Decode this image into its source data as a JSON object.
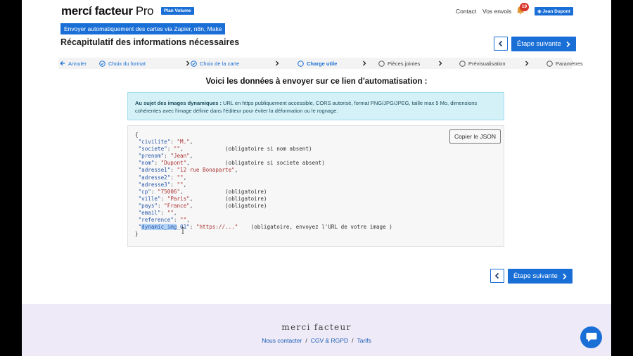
{
  "header": {
    "logo": "mercí facteur",
    "logo_suffix": "Pro",
    "plan_badge": "Plan Volume",
    "contact": "Contact",
    "my_sends": "Vos envois",
    "notif_count": "19",
    "user": "Jean Dupont"
  },
  "banner": "Envoyer automatiquement des cartes via Zapier, n8n, Make",
  "page_title": "Récapitulatif des informations nécessaires",
  "next_step": "Étape suivante",
  "stepper": {
    "cancel": "Annuler",
    "steps": [
      {
        "label": "Choix du format",
        "state": "done"
      },
      {
        "label": "Choix de la carte",
        "state": "done"
      },
      {
        "label": "Charge utile",
        "state": "current"
      },
      {
        "label": "Pièces jointes",
        "state": "todo"
      },
      {
        "label": "Prévisualisation",
        "state": "todo"
      },
      {
        "label": "Paramètres",
        "state": "todo"
      }
    ]
  },
  "lead": "Voici les données à envoyer sur ce lien d'automatisation :",
  "info": {
    "title": "Au sujet des images dynamiques :",
    "text": " URL en https publiquement accessible, CORS autorisé, format PNG/JPG/JPEG, taille max 5 Mo, dimensions cohérentes avec l'image définie dans l'éditeur pour éviter la déformation ou le rognage."
  },
  "copy_json": "Copier le JSON",
  "json_fields": [
    {
      "key": "civilite",
      "value": "M.",
      "comment": ""
    },
    {
      "key": "societe",
      "value": "",
      "comment": "(obligatoire si nom absent)"
    },
    {
      "key": "prenom",
      "value": "Jean",
      "comment": ""
    },
    {
      "key": "nom",
      "value": "Dupont",
      "comment": "(obligatoire si societe absent)"
    },
    {
      "key": "adresse1",
      "value": "12 rue Bonaparte",
      "comment": ""
    },
    {
      "key": "adresse2",
      "value": "",
      "comment": ""
    },
    {
      "key": "adresse3",
      "value": "",
      "comment": ""
    },
    {
      "key": "cp",
      "value": "75006",
      "comment": "(obligatoire)"
    },
    {
      "key": "ville",
      "value": "Paris",
      "comment": "(obligatoire)"
    },
    {
      "key": "pays",
      "value": "France",
      "comment": "(obligatoire)"
    },
    {
      "key": "email",
      "value": "",
      "comment": ""
    },
    {
      "key": "reference",
      "value": "",
      "comment": ""
    },
    {
      "key": "dynamic_img_01",
      "value": "https://...",
      "comment": "(obligatoire, envoyez l'URL de votre image )"
    }
  ],
  "json_selected": "dynamic_img",
  "footer": {
    "logo": "merci facteur",
    "links": [
      "Nous contacter",
      "CGV & RGPD",
      "Tarifs"
    ]
  },
  "colors": {
    "accent": "#1a6fd6",
    "info_bg": "#d4f1f8",
    "footer_bg": "#eeeaf8",
    "badge_red": "#d9342b"
  }
}
